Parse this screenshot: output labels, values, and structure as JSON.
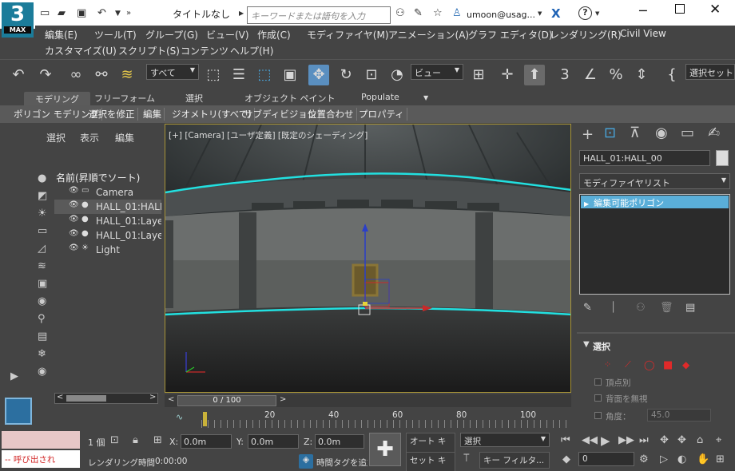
{
  "app": {
    "logo_number": "3",
    "logo_text": "MAX",
    "doc_title": "タイトルなし"
  },
  "search": {
    "placeholder": "キーワードまたは語句を入力"
  },
  "user": {
    "name": "umoon@usag..."
  },
  "menus": [
    "編集(E)",
    "ツール(T)",
    "グループ(G)",
    "ビュー(V)",
    "作成(C)",
    "モディファイヤ(M)",
    "アニメーション(A)",
    "グラフ エディタ(D)",
    "レンダリング(R)",
    "Civil View",
    "カスタマイズ(U)",
    "スクリプト(S)",
    "コンテンツ",
    "ヘルプ(H)"
  ],
  "toolbar": {
    "filter": "すべて",
    "refcoord": "ビュー",
    "selset": "選択セット"
  },
  "ribbon": {
    "tabs": [
      "モデリング",
      "フリーフォーム",
      "選択",
      "オブジェクト ペイント",
      "Populate"
    ]
  },
  "subribbon": [
    "ポリゴン モデリング",
    "選択を修正",
    "編集",
    "ジオメトリ(すべて)",
    "サブディビジョン",
    "位置合わせ",
    "プロパティ"
  ],
  "scene_explorer": {
    "menu": [
      "選択",
      "表示",
      "編集"
    ],
    "header": "名前(昇順でソート)",
    "items": [
      "Camera",
      "HALL_01:HALL",
      "HALL_01:Laye",
      "HALL_01:Laye",
      "Light"
    ]
  },
  "viewport": {
    "label": "[+] [Camera] [ユーザ定義] [既定のシェーディング]"
  },
  "timeslider": {
    "value": "0 / 100",
    "ticks": [
      "20",
      "40",
      "60",
      "80",
      "100"
    ]
  },
  "command_panel": {
    "object_name": "HALL_01:HALL_00",
    "modifier_list": "モディファイヤリスト",
    "stack_item": "編集可能ポリゴン",
    "rollout_title": "選択",
    "vertex": "頂点別",
    "ignore_back": "背面を無視",
    "angle_label": "角度：",
    "angle_value": "45.0"
  },
  "status": {
    "count": "1 個",
    "x_label": "X:",
    "x_value": "0.0m",
    "y_label": "Y:",
    "y_value": "0.0m",
    "z_label": "Z:",
    "z_value": "0.0m",
    "render_time_label": "レンダリング時間",
    "render_time": "0:00:00",
    "time_tag": "時間タグを追加",
    "autokey": "オート キー",
    "setkey": "セット キー",
    "selection": "選択",
    "key_filter": "キー フィルタ...",
    "frame": "0",
    "maxscript": "-- 呼び出され"
  },
  "colors": {
    "accent": "#1b7c9a",
    "viewport_border": "#a89437",
    "highlight": "#5aaed8",
    "edge": "#22e0e0"
  }
}
